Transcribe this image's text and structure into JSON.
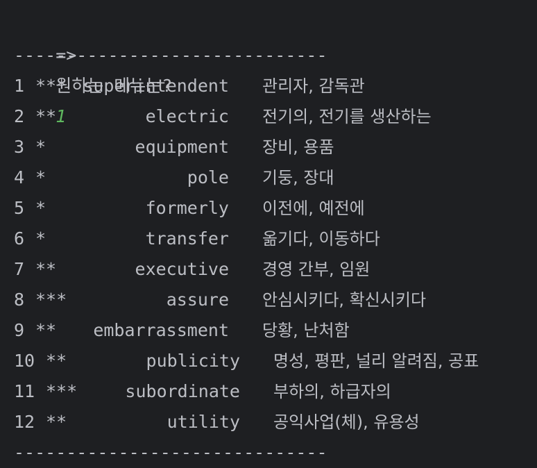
{
  "prompt": {
    "arrow": "=>",
    "question": "원하는 메뉴는?",
    "input": "1"
  },
  "separator_top": "------------------------------",
  "separator_bottom": "------------------------------",
  "rows": [
    {
      "num": "1",
      "stars": "***",
      "word": "superintendent",
      "meaning": "관리자, 감독관"
    },
    {
      "num": "2",
      "stars": "**",
      "word": "electric",
      "meaning": "전기의, 전기를 생산하는"
    },
    {
      "num": "3",
      "stars": "*",
      "word": "equipment",
      "meaning": "장비, 용품"
    },
    {
      "num": "4",
      "stars": "*",
      "word": "pole",
      "meaning": "기둥, 장대"
    },
    {
      "num": "5",
      "stars": "*",
      "word": "formerly",
      "meaning": "이전에, 예전에"
    },
    {
      "num": "6",
      "stars": "*",
      "word": "transfer",
      "meaning": "옮기다, 이동하다"
    },
    {
      "num": "7",
      "stars": "**",
      "word": "executive",
      "meaning": "경영 간부, 임원"
    },
    {
      "num": "8",
      "stars": "***",
      "word": "assure",
      "meaning": "안심시키다, 확신시키다"
    },
    {
      "num": "9",
      "stars": "**",
      "word": "embarrassment",
      "meaning": "당황, 난처함"
    },
    {
      "num": "10",
      "stars": "**",
      "word": "publicity",
      "meaning": "명성, 평판, 널리 알려짐, 공표"
    },
    {
      "num": "11",
      "stars": "***",
      "word": "subordinate",
      "meaning": "부하의, 하급자의"
    },
    {
      "num": "12",
      "stars": "**",
      "word": "utility",
      "meaning": "공익사업(체), 유용성"
    }
  ],
  "colors": {
    "background": "#1e1f22",
    "text": "#bcbec4",
    "input": "#5fb85f"
  }
}
